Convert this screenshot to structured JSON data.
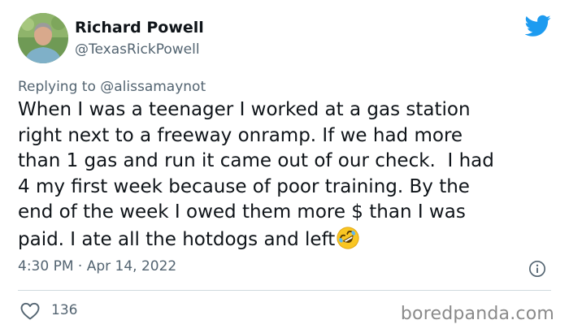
{
  "author": {
    "display_name": "Richard Powell",
    "handle": "@TexasRickPowell"
  },
  "icons": {
    "brand": "twitter-bird-icon",
    "brand_color": "#1d9bf0",
    "info": "info-icon",
    "like": "heart-icon",
    "emoji": "rolling-on-floor-laughing-emoji"
  },
  "reply": {
    "prefix": "Replying to",
    "target": "@alissamaynot"
  },
  "tweet": {
    "lines": [
      "When I was a teenager I worked at a gas station",
      "right next to a freeway onramp. If we had more",
      "than 1 gas and run it came out of our check.  I had",
      "4 my first week because of poor training. By the",
      "end of the week I owed them more $ than I was",
      "paid. I ate all the hotdogs and left"
    ]
  },
  "meta": {
    "time": "4:30 PM",
    "separator": "·",
    "date": "Apr 14, 2022"
  },
  "engagement": {
    "likes": "136"
  },
  "watermark": "boredpanda.com"
}
